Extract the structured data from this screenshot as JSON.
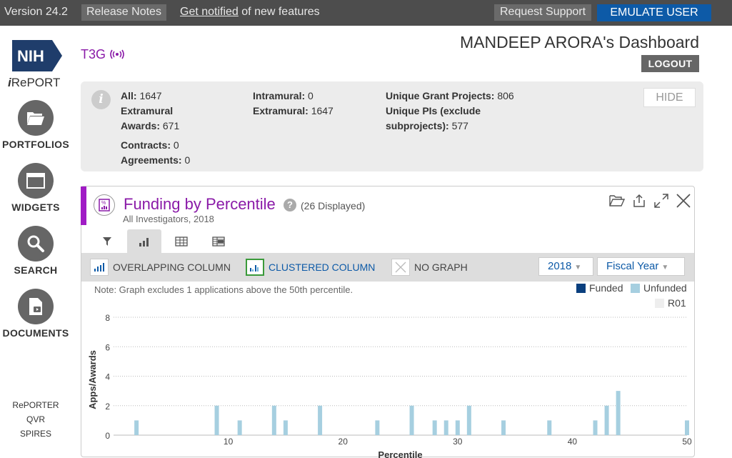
{
  "topbar": {
    "version": "Version 24.2",
    "release_notes": "Release Notes",
    "notify_link": "Get notified",
    "notify_rest": " of new features",
    "request_support": "Request Support",
    "emulate_user": "EMULATE USER"
  },
  "sidebar": {
    "logo_text": "NIH",
    "ireport_i": "i",
    "ireport_rest": "RePORT",
    "items": [
      {
        "label": "PORTFOLIOS",
        "icon": "folder-icon"
      },
      {
        "label": "WIDGETS",
        "icon": "window-icon"
      },
      {
        "label": "SEARCH",
        "icon": "magnifier-icon"
      },
      {
        "label": "DOCUMENTS",
        "icon": "document-play-icon"
      }
    ],
    "links": [
      "RePORTER",
      "QVR",
      "SPIRES"
    ]
  },
  "header": {
    "portfolio": "T3G",
    "title": "MANDEEP ARORA's Dashboard",
    "logout": "LOGOUT"
  },
  "summary": {
    "all_label": "All:",
    "all_value": " 1647",
    "extramural_awards_label": "Extramural Awards:",
    "extramural_awards_value": " 671",
    "contracts_label": "Contracts:",
    "contracts_value": " 0",
    "agreements_label": "Agreements:",
    "agreements_value": " 0",
    "intramural_label": "Intramural:",
    "intramural_value": " 0",
    "extramural_label": "Extramural:",
    "extramural_value": " 1647",
    "unique_projects_label": "Unique Grant Projects:",
    "unique_projects_value": " 806",
    "unique_pis_label": "Unique PIs (exclude subprojects):",
    "unique_pis_value": " 577",
    "hide": "HIDE"
  },
  "widget": {
    "title": "Funding by Percentile",
    "help": "?",
    "count": "(26 Displayed)",
    "subtitle": "All Investigators, 2018",
    "graph_options": [
      {
        "label": "OVERLAPPING COLUMN",
        "active": false
      },
      {
        "label": "CLUSTERED COLUMN",
        "active": true
      },
      {
        "label": "NO GRAPH",
        "active": false
      }
    ],
    "year": "2018",
    "year_type": "Fiscal Year",
    "note": "Note: Graph excludes 1 applications above the 50th percentile.",
    "legend": [
      {
        "label": "Funded",
        "color": "#0a3f7e"
      },
      {
        "label": "Unfunded",
        "color": "#a6cfe0"
      },
      {
        "label": "R01",
        "color": "#eeeeee"
      }
    ]
  },
  "chart_data": {
    "type": "bar",
    "xlabel": "Percentile",
    "ylabel": "Apps/Awards",
    "xlim": [
      0,
      50
    ],
    "ylim": [
      0,
      8
    ],
    "xticks": [
      10,
      20,
      30,
      40,
      50
    ],
    "yticks": [
      0,
      2,
      4,
      6,
      8
    ],
    "grid": true,
    "series": [
      {
        "name": "Unfunded",
        "x": [
          2,
          9,
          11,
          14,
          15,
          18,
          23,
          26,
          28,
          29,
          30,
          31,
          34,
          38,
          42,
          43,
          44,
          50
        ],
        "values": [
          1,
          2,
          1,
          2,
          1,
          2,
          1,
          2,
          1,
          1,
          1,
          2,
          1,
          1,
          1,
          2,
          3,
          1
        ]
      }
    ]
  }
}
